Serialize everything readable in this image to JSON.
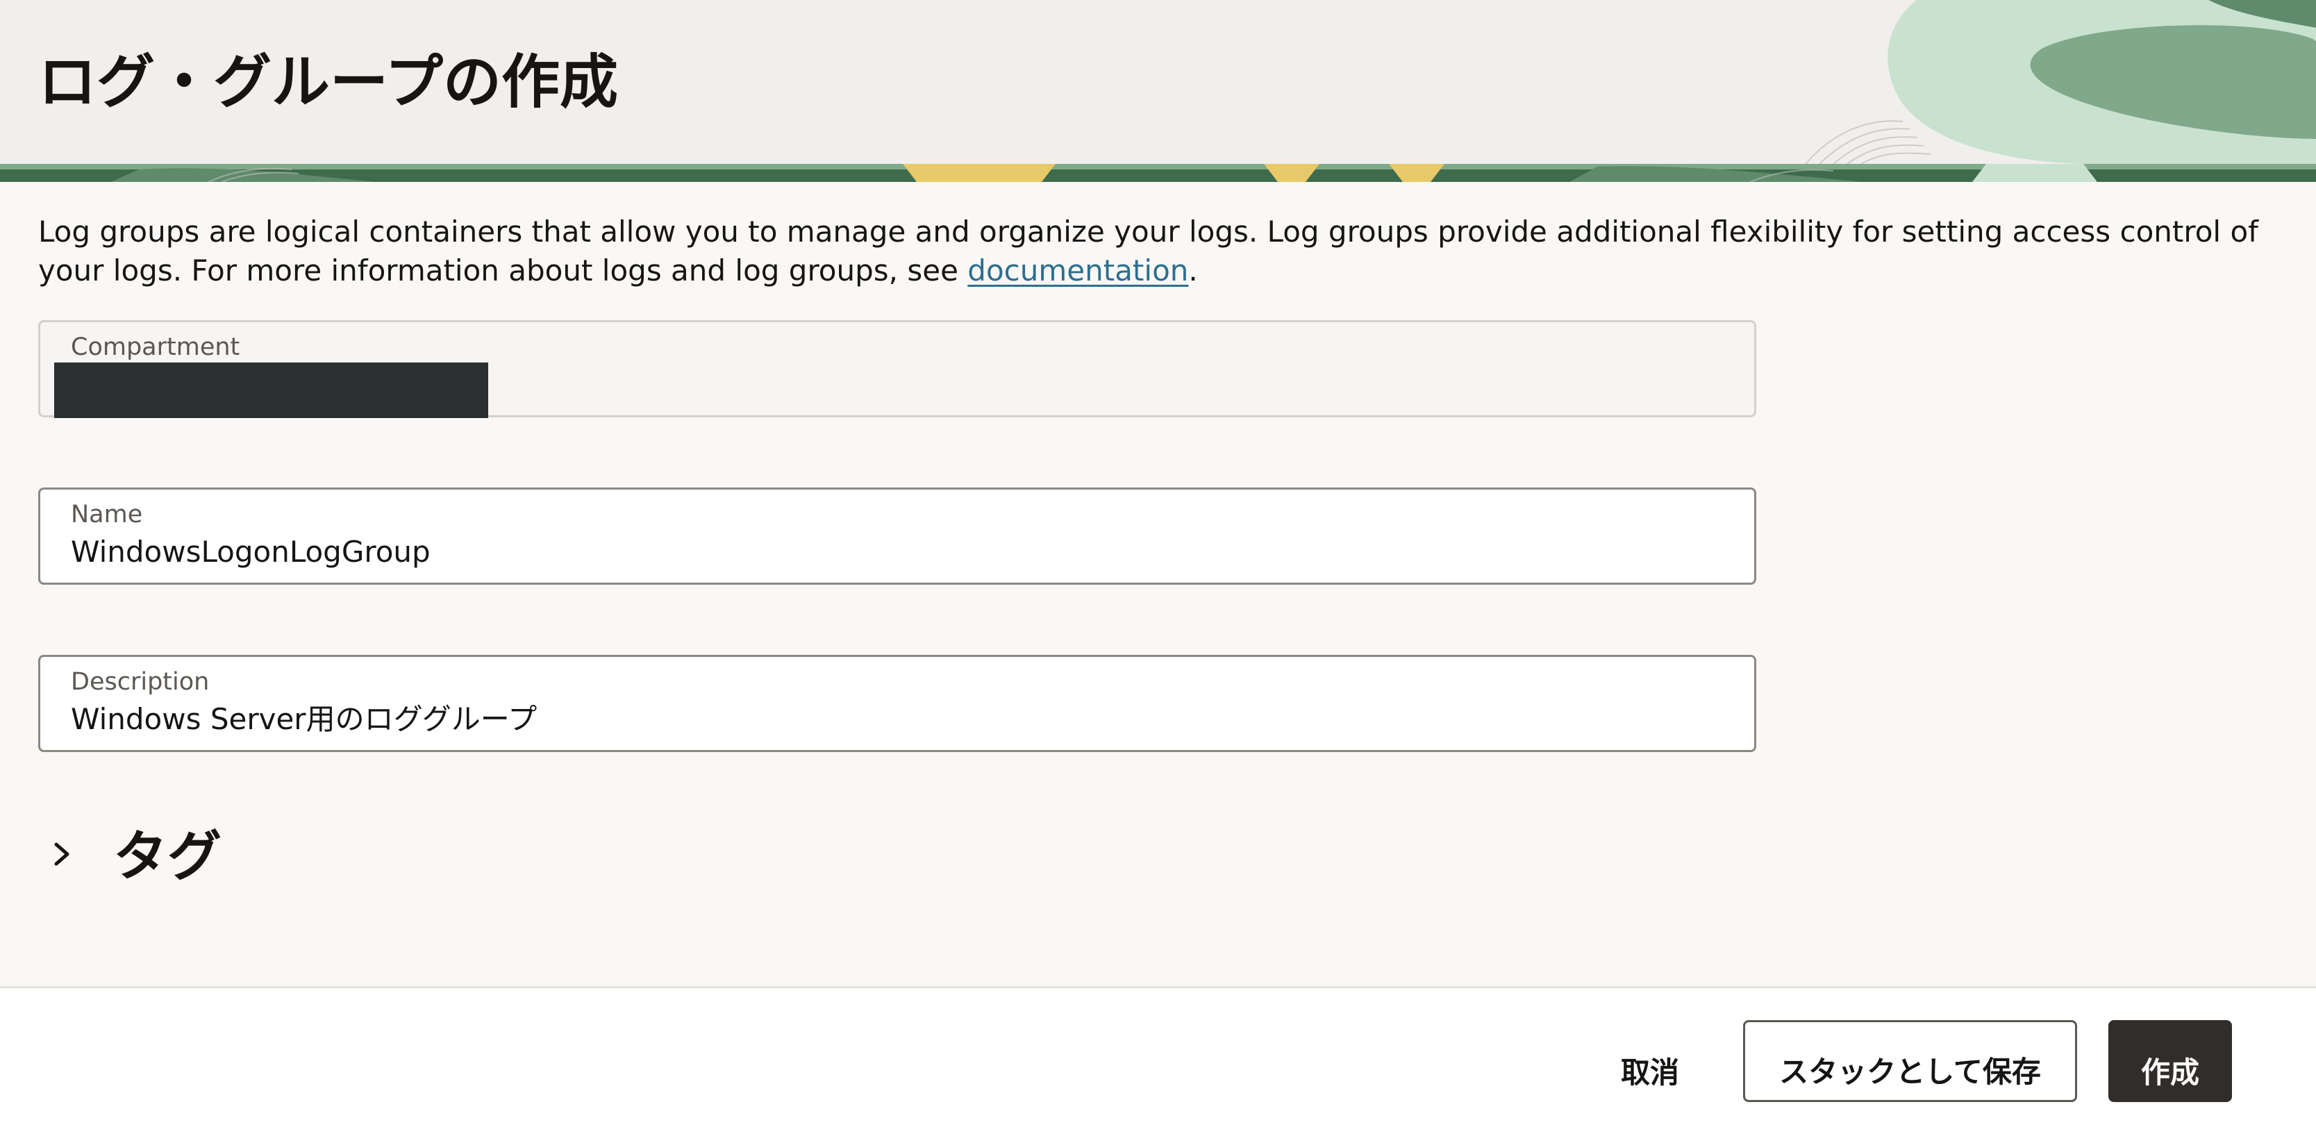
{
  "header": {
    "title": "ログ・グループの作成"
  },
  "intro": {
    "text_before_link": "Log groups are logical containers that allow you to manage and organize your logs. Log groups provide additional flexibility for setting access control of your logs. For more information about logs and log groups, see ",
    "link_text": "documentation",
    "text_after_link": "."
  },
  "compartment": {
    "label": "Compartment",
    "value_redacted": true
  },
  "name_field": {
    "label": "Name",
    "value": "WindowsLogonLogGroup"
  },
  "description_field": {
    "label": "Description",
    "value": "Windows Server用のロググループ"
  },
  "tags": {
    "label": "タグ",
    "icon": "chevron-right-icon"
  },
  "footer": {
    "cancel_label": "取消",
    "save_stack_label": "スタックとして保存",
    "create_label": "作成"
  },
  "colors": {
    "header_bg": "#f1efed",
    "art_green_light": "#c9e2cf",
    "art_green_mid": "#80a88a",
    "art_green_dark": "#3e6b4c",
    "art_yellow": "#e8c96a",
    "link": "#2c6f8f",
    "primary_button": "#312d2a"
  }
}
